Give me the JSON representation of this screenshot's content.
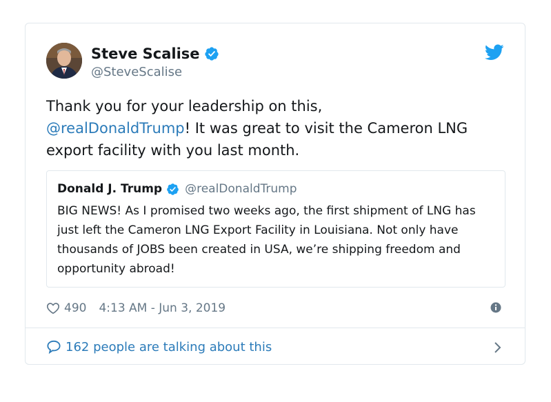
{
  "tweet": {
    "author": {
      "display_name": "Steve Scalise",
      "handle": "@SteveScalise",
      "verified": true
    },
    "text_before_mention": "Thank you for your leadership on this,",
    "mention": "@realDonaldTrump",
    "text_after_mention": "! It was great to visit the Cameron LNG export facility with you last month.",
    "likes": "490",
    "timestamp": "4:13 AM - Jun 3, 2019",
    "conversation_label": "162 people are talking about this"
  },
  "quoted_tweet": {
    "display_name": "Donald J. Trump",
    "handle": "@realDonaldTrump",
    "verified": true,
    "text": "BIG NEWS! As I promised two weeks ago, the first shipment of LNG has just left the Cameron LNG Export Facility in Louisiana. Not only have thousands of JOBS been created in USA, we’re shipping freedom and opportunity abroad!"
  },
  "colors": {
    "brand_blue": "#1da1f2",
    "link_blue": "#2b7bb9",
    "muted_gray": "#657786",
    "border": "#e1e8ed"
  },
  "icons": [
    "verified-badge-icon",
    "twitter-bird-icon",
    "heart-icon",
    "info-icon",
    "speech-bubble-icon",
    "chevron-right-icon"
  ]
}
